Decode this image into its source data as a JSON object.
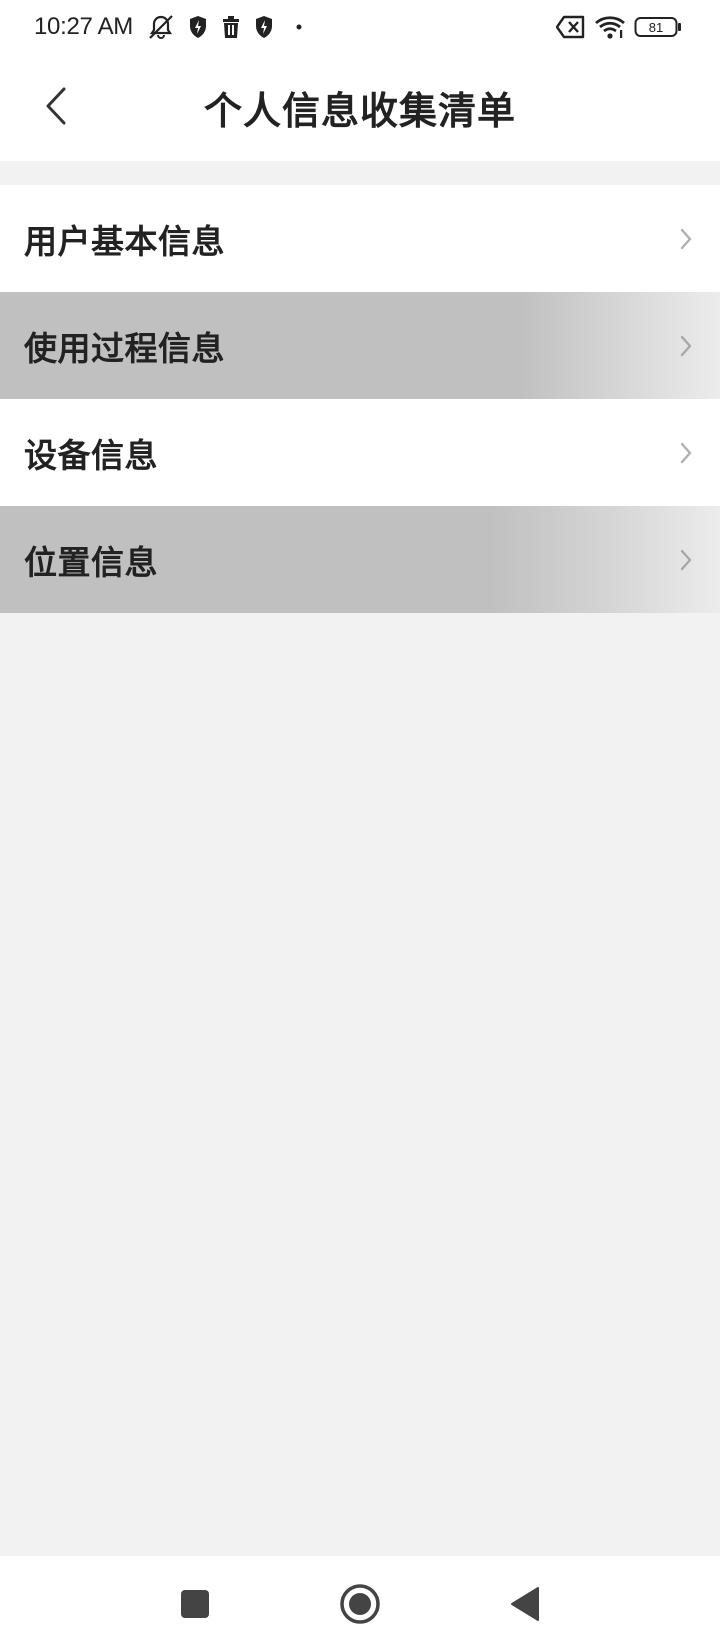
{
  "status_bar": {
    "time": "10:27 AM",
    "battery_level": "81",
    "icons": [
      "mute-notifications-icon",
      "shield-bolt-icon",
      "trash-icon",
      "shield-bolt-icon",
      "dot-icon",
      "no-sim-icon",
      "wifi-icon",
      "battery-icon"
    ]
  },
  "header": {
    "title": "个人信息收集清单",
    "back_icon": "back-chevron-icon"
  },
  "menu": {
    "items": [
      {
        "label": "用户基本信息",
        "state": "normal"
      },
      {
        "label": "使用过程信息",
        "state": "pressed"
      },
      {
        "label": "设备信息",
        "state": "normal"
      },
      {
        "label": "位置信息",
        "state": "pressed"
      }
    ]
  },
  "nav_bar": {
    "buttons": [
      "recents-square-icon",
      "home-circle-icon",
      "back-triangle-icon"
    ]
  },
  "colors": {
    "background": "#f2f2f2",
    "surface": "#ffffff",
    "pressed": "#c0c0c0",
    "text": "#222222",
    "chevron": "#b0b0b0"
  }
}
